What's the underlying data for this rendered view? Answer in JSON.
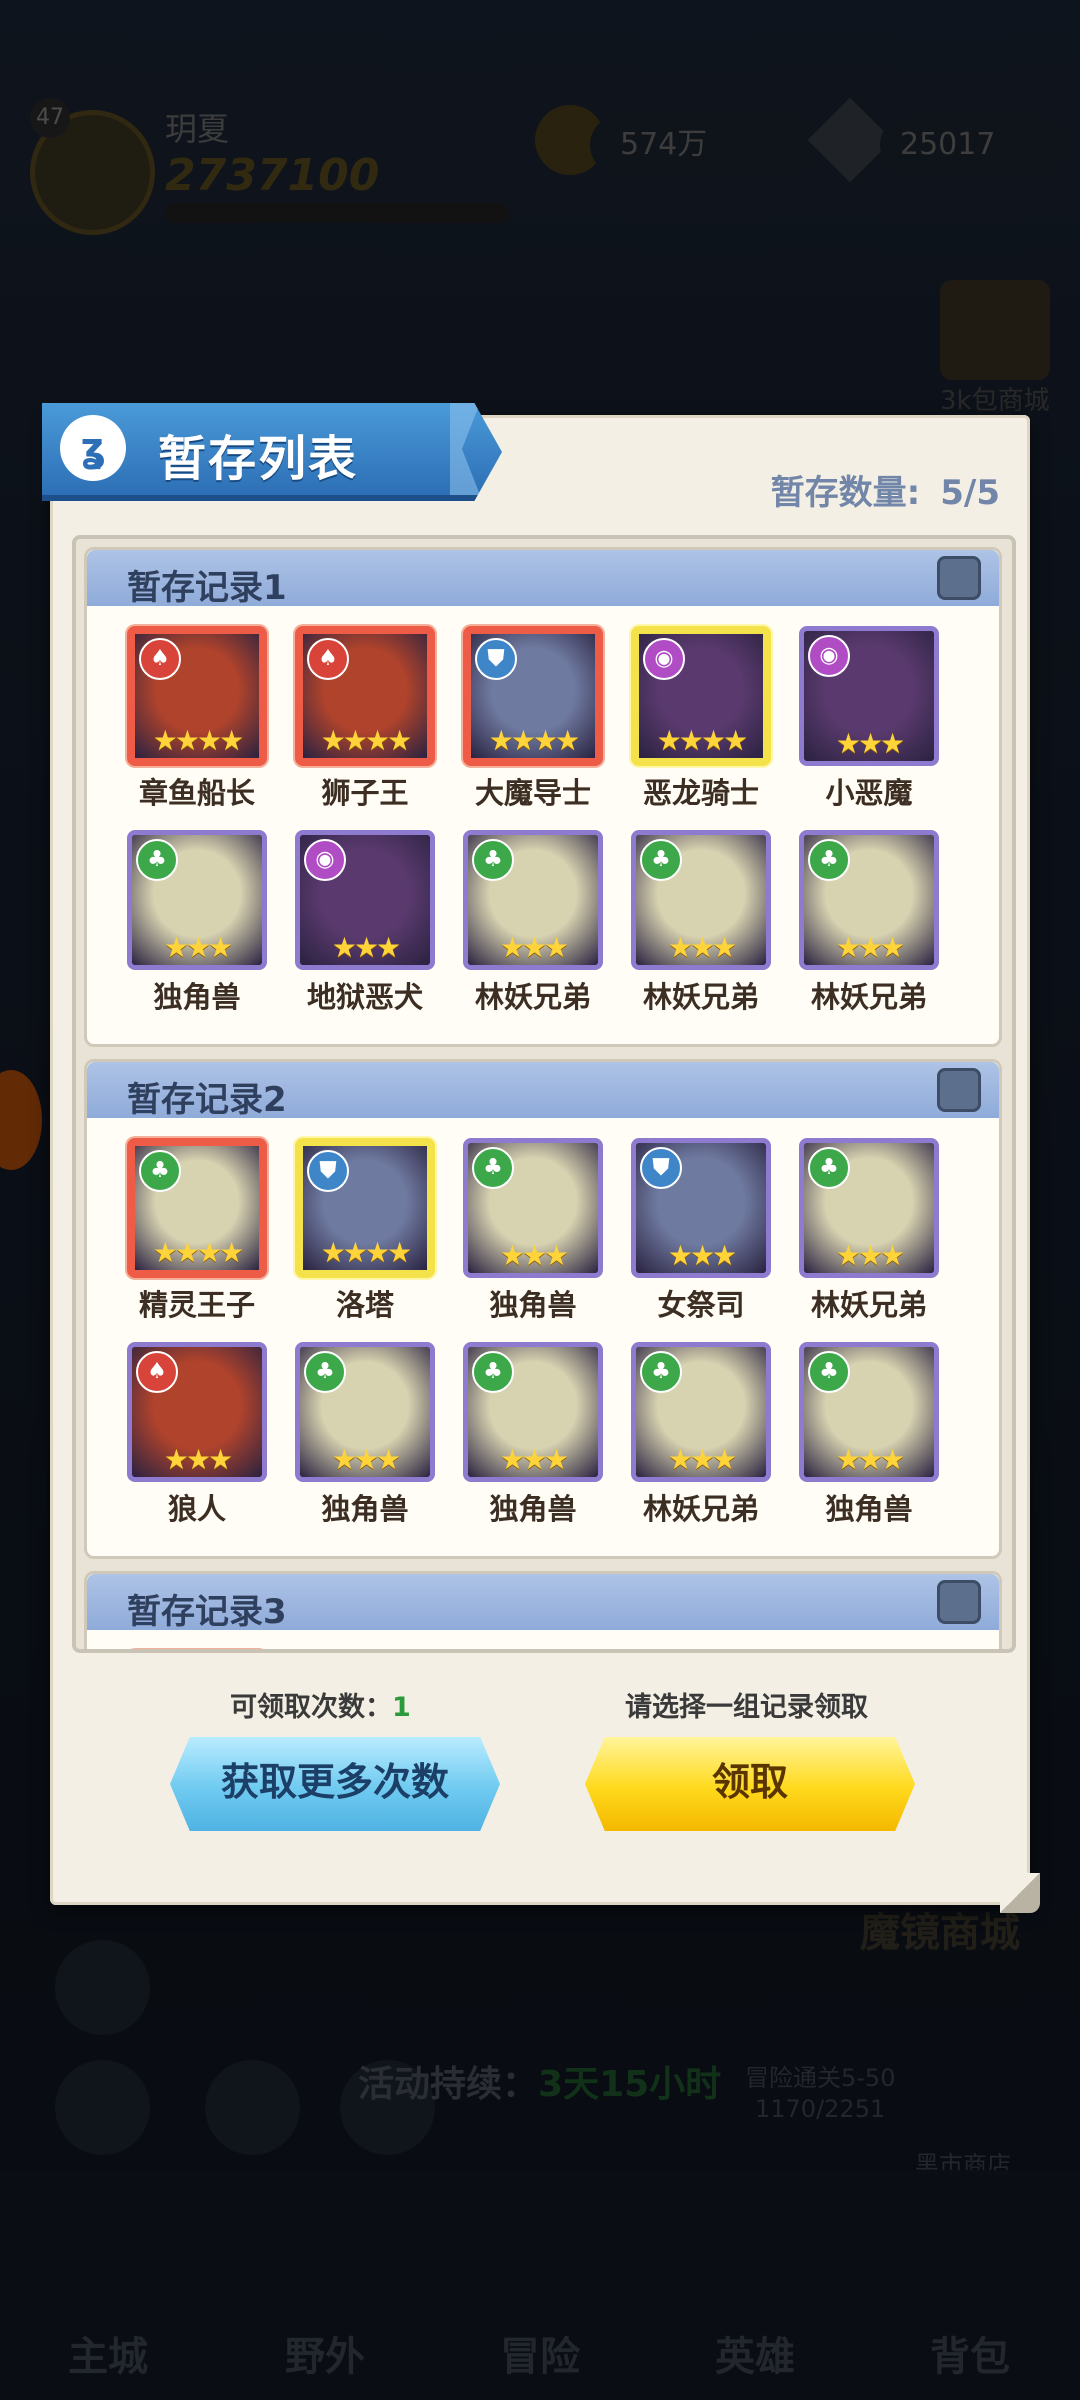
{
  "background": {
    "player_level": "47",
    "player_name": "玥夏",
    "power": "2737100",
    "coins": "574万",
    "gems": "25017",
    "activity_label": "活动持续：",
    "activity_time": "3天15小时",
    "right_label": "3k包商城",
    "mofa_label": "魔镜商城",
    "progress_text": "冒险通关5-50",
    "progress_value": "1170/2251",
    "shop_label": "黑市商店",
    "nav": [
      "主城",
      "野外",
      "冒险",
      "英雄",
      "背包"
    ]
  },
  "dialog": {
    "title": "暂存列表",
    "count_label": "暂存数量:",
    "count_value": "5/5",
    "records": [
      {
        "title": "暂存记录1",
        "heroes": [
          {
            "name": "章鱼船长",
            "stars": "★★★★",
            "rarity": "red",
            "faction": "fire"
          },
          {
            "name": "狮子王",
            "stars": "★★★★",
            "rarity": "red",
            "faction": "fire"
          },
          {
            "name": "大魔导士",
            "stars": "★★★★",
            "rarity": "red",
            "faction": "holy"
          },
          {
            "name": "恶龙骑士",
            "stars": "★★★★",
            "rarity": "gold",
            "faction": "dark"
          },
          {
            "name": "小恶魔",
            "stars": "★★★",
            "rarity": "purple",
            "faction": "dark"
          },
          {
            "name": "独角兽",
            "stars": "★★★",
            "rarity": "purple",
            "faction": "nature"
          },
          {
            "name": "地狱恶犬",
            "stars": "★★★",
            "rarity": "purple",
            "faction": "dark"
          },
          {
            "name": "林妖兄弟",
            "stars": "★★★",
            "rarity": "purple",
            "faction": "nature"
          },
          {
            "name": "林妖兄弟",
            "stars": "★★★",
            "rarity": "purple",
            "faction": "nature"
          },
          {
            "name": "林妖兄弟",
            "stars": "★★★",
            "rarity": "purple",
            "faction": "nature"
          }
        ]
      },
      {
        "title": "暂存记录2",
        "heroes": [
          {
            "name": "精灵王子",
            "stars": "★★★★",
            "rarity": "red",
            "faction": "nature"
          },
          {
            "name": "洛塔",
            "stars": "★★★★",
            "rarity": "gold",
            "faction": "holy"
          },
          {
            "name": "独角兽",
            "stars": "★★★",
            "rarity": "purple",
            "faction": "nature"
          },
          {
            "name": "女祭司",
            "stars": "★★★",
            "rarity": "purple",
            "faction": "holy"
          },
          {
            "name": "林妖兄弟",
            "stars": "★★★",
            "rarity": "purple",
            "faction": "nature"
          },
          {
            "name": "狼人",
            "stars": "★★★",
            "rarity": "purple",
            "faction": "fire"
          },
          {
            "name": "独角兽",
            "stars": "★★★",
            "rarity": "purple",
            "faction": "nature"
          },
          {
            "name": "独角兽",
            "stars": "★★★",
            "rarity": "purple",
            "faction": "nature"
          },
          {
            "name": "林妖兄弟",
            "stars": "★★★",
            "rarity": "purple",
            "faction": "nature"
          },
          {
            "name": "独角兽",
            "stars": "★★★",
            "rarity": "purple",
            "faction": "nature"
          }
        ]
      },
      {
        "title": "暂存记录3",
        "heroes": [
          {
            "rarity": "red",
            "faction": "nature"
          },
          {
            "rarity": "purple",
            "faction": "holy"
          },
          {
            "rarity": "purple",
            "faction": "nature"
          },
          {
            "rarity": "purple",
            "faction": "nature"
          },
          {
            "rarity": "purple",
            "faction": "fire"
          }
        ]
      }
    ],
    "claim_count_label": "可领取次数：",
    "claim_count_value": "1",
    "select_hint": "请选择一组记录领取",
    "more_button": "获取更多次数",
    "claim_button": "领取"
  },
  "colors": {
    "faction_fire": "#d8443a",
    "faction_holy": "#3e86c8",
    "faction_dark": "#b04cc4",
    "faction_nature": "#3ca84a",
    "portrait_fire": "#b0432c",
    "portrait_holy": "#6f7aa0",
    "portrait_dark": "#5a3a6e",
    "portrait_nature": "#d7d2b0"
  },
  "icons": {
    "title": "bunny-logo-icon",
    "fire": "fire-faction-icon",
    "holy": "helmet-faction-icon",
    "dark": "dark-faction-icon",
    "nature": "tree-faction-icon"
  }
}
